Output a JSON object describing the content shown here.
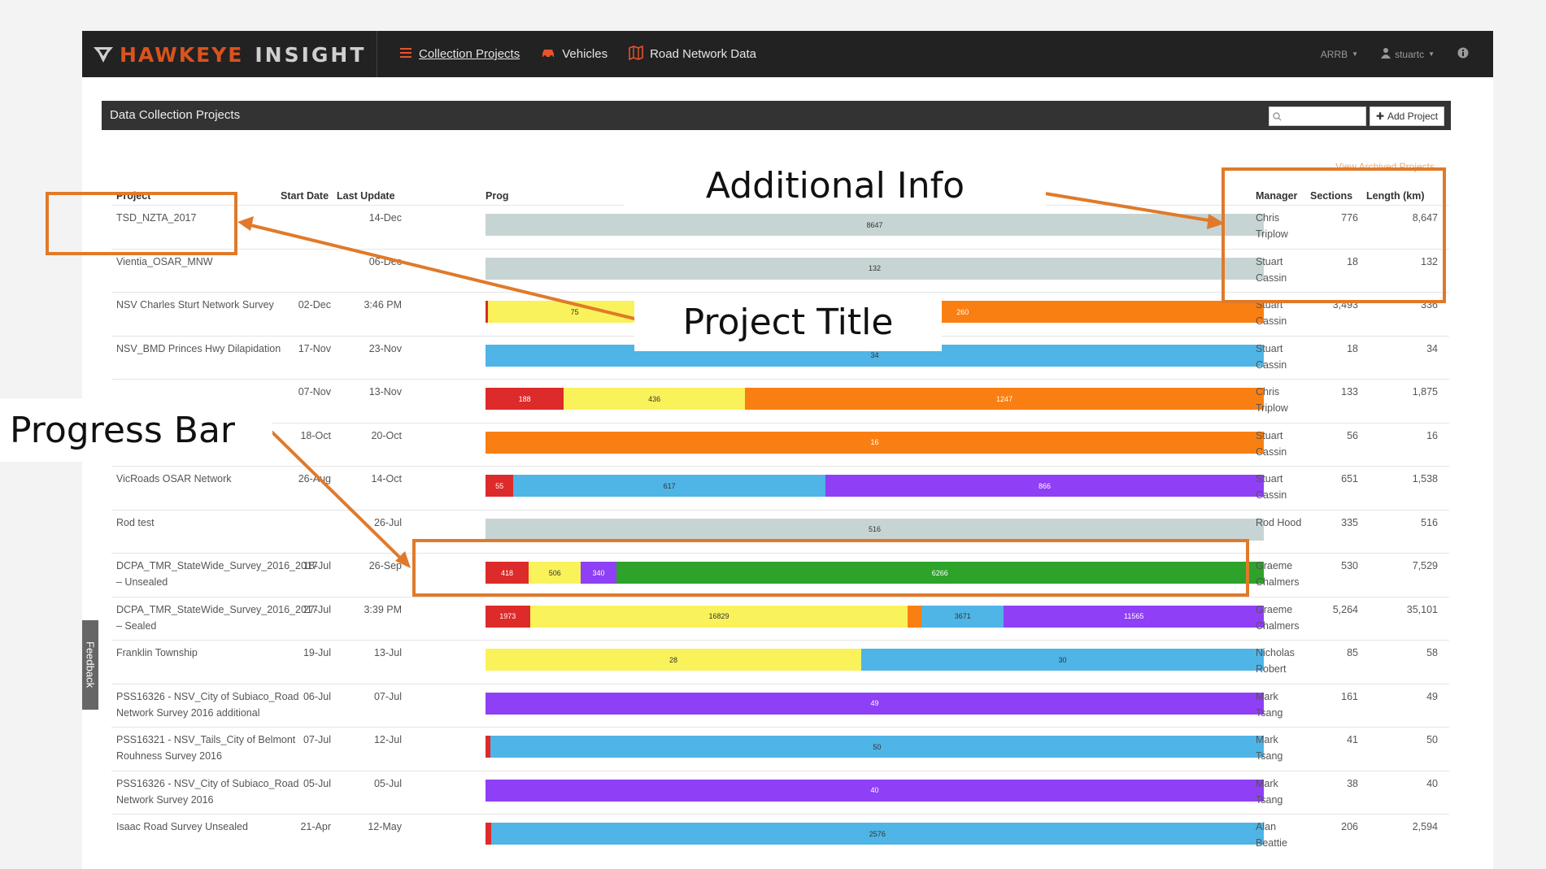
{
  "navbar": {
    "brand_name": "HAWKEYE",
    "brand_sub": "INSIGHT",
    "links": [
      {
        "label": "Collection Projects",
        "icon": "list-icon",
        "active": true
      },
      {
        "label": "Vehicles",
        "icon": "car-icon",
        "active": false
      },
      {
        "label": "Road Network Data",
        "icon": "map-icon",
        "active": false
      }
    ],
    "org_menu": "ARRB",
    "user_menu": "stuartc"
  },
  "panel": {
    "title": "Data Collection Projects",
    "search_placeholder": "",
    "add_label": "Add Project",
    "archived_link": "View Archived Projects"
  },
  "table": {
    "headers": {
      "project": "Project",
      "start": "Start Date",
      "last": "Last Update",
      "progress": "Prog",
      "manager": "Manager",
      "sections": "Sections",
      "length": "Length (km)"
    },
    "rows": [
      {
        "project": "TSD_NZTA_2017",
        "start": "",
        "last": "14-Dec",
        "manager": "Chris Triplow",
        "sections": "776",
        "length": "8,647",
        "segments": [
          {
            "color": "#c7d4d4",
            "value": 8647,
            "label": "8647"
          }
        ]
      },
      {
        "project": "Vientia_OSAR_MNW",
        "start": "",
        "last": "06-Dec",
        "manager": "Stuart Cassin",
        "sections": "18",
        "length": "132",
        "segments": [
          {
            "color": "#c7d4d4",
            "value": 132,
            "label": "132"
          }
        ]
      },
      {
        "project": "NSV Charles Sturt Network Survey",
        "start": "02-Dec",
        "last": "3:46 PM",
        "manager": "Stuart Cassin",
        "sections": "3,493",
        "length": "336",
        "segments": [
          {
            "color": "#dd2a2a",
            "value": 1,
            "label": ""
          },
          {
            "color": "#faf25a",
            "value": 75,
            "label": "75"
          },
          {
            "color": "#fa7f12",
            "value": 260,
            "label": "260"
          }
        ]
      },
      {
        "project": "NSV_BMD Princes Hwy Dilapidation",
        "start": "17-Nov",
        "last": "23-Nov",
        "manager": "Stuart Cassin",
        "sections": "18",
        "length": "34",
        "segments": [
          {
            "color": "#4fb4e6",
            "value": 34,
            "label": "34"
          }
        ]
      },
      {
        "project": "",
        "start": "07-Nov",
        "last": "13-Nov",
        "manager": "Chris Triplow",
        "sections": "133",
        "length": "1,875",
        "segments": [
          {
            "color": "#dd2a2a",
            "value": 188,
            "label": "188"
          },
          {
            "color": "#faf25a",
            "value": 436,
            "label": "436"
          },
          {
            "color": "#fa7f12",
            "value": 1247,
            "label": "1247"
          }
        ]
      },
      {
        "project": "",
        "start": "18-Oct",
        "last": "20-Oct",
        "manager": "Stuart Cassin",
        "sections": "56",
        "length": "16",
        "segments": [
          {
            "color": "#fa7f12",
            "value": 16,
            "label": "16"
          }
        ]
      },
      {
        "project": "VicRoads OSAR Network",
        "start": "26-Aug",
        "last": "14-Oct",
        "manager": "Stuart Cassin",
        "sections": "651",
        "length": "1,538",
        "segments": [
          {
            "color": "#dd2a2a",
            "value": 55,
            "label": "55"
          },
          {
            "color": "#4fb4e6",
            "value": 617,
            "label": "617"
          },
          {
            "color": "#8f3ff5",
            "value": 866,
            "label": "866"
          }
        ]
      },
      {
        "project": "Rod test",
        "start": "",
        "last": "26-Jul",
        "manager": "Rod Hood",
        "sections": "335",
        "length": "516",
        "segments": [
          {
            "color": "#c7d4d4",
            "value": 516,
            "label": "516"
          }
        ]
      },
      {
        "project": "DCPA_TMR_StateWide_Survey_2016_2017 – Unsealed",
        "start": "18-Jul",
        "last": "26-Sep",
        "manager": "Graeme Chalmers",
        "sections": "530",
        "length": "7,529",
        "segments": [
          {
            "color": "#dd2a2a",
            "value": 418,
            "label": "418"
          },
          {
            "color": "#faf25a",
            "value": 506,
            "label": "506"
          },
          {
            "color": "#8f3ff5",
            "value": 340,
            "label": "340"
          },
          {
            "color": "#2ea32a",
            "value": 6266,
            "label": "6266"
          }
        ]
      },
      {
        "project": "DCPA_TMR_StateWide_Survey_2016_2017 – Sealed",
        "start": "27-Jul",
        "last": "3:39 PM",
        "manager": "Graeme Chalmers",
        "sections": "5,264",
        "length": "35,101",
        "segments": [
          {
            "color": "#dd2a2a",
            "value": 1973,
            "label": "1973"
          },
          {
            "color": "#faf25a",
            "value": 16829,
            "label": "16829"
          },
          {
            "color": "#fa7f12",
            "value": 600,
            "label": ""
          },
          {
            "color": "#4fb4e6",
            "value": 3671,
            "label": "3671"
          },
          {
            "color": "#8f3ff5",
            "value": 11565,
            "label": "11565"
          }
        ]
      },
      {
        "project": "Franklin Township",
        "start": "19-Jul",
        "last": "13-Jul",
        "manager": "Nicholas Robert",
        "sections": "85",
        "length": "58",
        "segments": [
          {
            "color": "#faf25a",
            "value": 28,
            "label": "28"
          },
          {
            "color": "#4fb4e6",
            "value": 30,
            "label": "30"
          }
        ]
      },
      {
        "project": "PSS16326 - NSV_City of Subiaco_Road Network Survey 2016 additional",
        "start": "06-Jul",
        "last": "07-Jul",
        "manager": "Mark Tsang",
        "sections": "161",
        "length": "49",
        "segments": [
          {
            "color": "#8f3ff5",
            "value": 49,
            "label": "49"
          }
        ]
      },
      {
        "project": "PSS16321 - NSV_Tails_City of Belmont Rouhness Survey 2016",
        "start": "07-Jul",
        "last": "12-Jul",
        "manager": "Mark Tsang",
        "sections": "41",
        "length": "50",
        "segments": [
          {
            "color": "#dd2a2a",
            "value": 0.3,
            "label": ""
          },
          {
            "color": "#4fb4e6",
            "value": 50,
            "label": "50"
          }
        ]
      },
      {
        "project": "PSS16326 - NSV_City of Subiaco_Road Network Survey 2016",
        "start": "05-Jul",
        "last": "05-Jul",
        "manager": "Mark Tsang",
        "sections": "38",
        "length": "40",
        "segments": [
          {
            "color": "#8f3ff5",
            "value": 40,
            "label": "40"
          }
        ]
      },
      {
        "project": "Isaac Road Survey Unsealed",
        "start": "21-Apr",
        "last": "12-May",
        "manager": "Alan Beattie",
        "sections": "206",
        "length": "2,594",
        "segments": [
          {
            "color": "#dd2a2a",
            "value": 18,
            "label": ""
          },
          {
            "color": "#4fb4e6",
            "value": 2576,
            "label": "2576"
          }
        ]
      }
    ]
  },
  "feedback_tab": "Feedback",
  "callouts": {
    "additional_info": "Additional Info",
    "project_title": "Project Title",
    "progress_bar": "Progress Bar",
    "accent_color": "#e07a2a"
  }
}
